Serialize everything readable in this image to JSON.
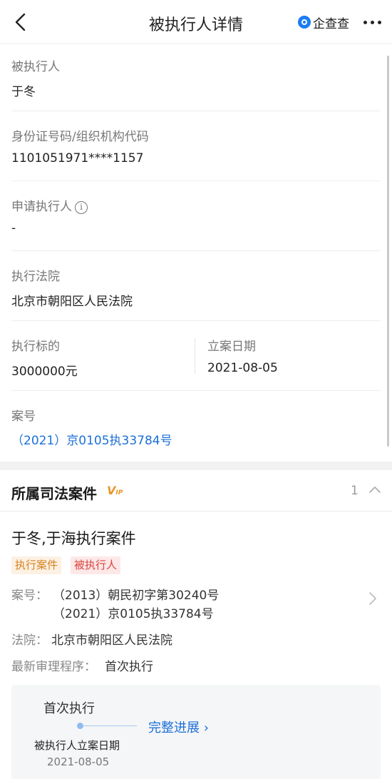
{
  "nav": {
    "title": "被执行人详情",
    "brand": "企查查"
  },
  "fields": {
    "person_label": "被执行人",
    "person_value": "于冬",
    "id_label": "身份证号码/组织机构代码",
    "id_value": "1101051971****1157",
    "applicant_label": "申请执行人",
    "applicant_value": "-",
    "court_label": "执行法院",
    "court_value": "北京市朝阳区人民法院",
    "target_label": "执行标的",
    "target_value": "3000000元",
    "filing_label": "立案日期",
    "filing_value": "2021-08-05",
    "case_no_label": "案号",
    "case_no_value": "（2021）京0105执33784号"
  },
  "section": {
    "title": "所属司法案件",
    "count": "1",
    "vip": "V",
    "vip_small": "IP"
  },
  "case": {
    "title": "于冬,于海执行案件",
    "tags": [
      "执行案件",
      "被执行人"
    ],
    "case_no_label": "案号：",
    "case_no_1": "（2013）朝民初字第30240号",
    "case_no_2": "（2021）京0105执33784号",
    "court_label": "法院：",
    "court_value": "北京市朝阳区人民法院",
    "procedure_label": "最新审理程序：",
    "procedure_value": "首次执行"
  },
  "progress": {
    "stage": "首次执行",
    "full_link": "完整进展 ›",
    "event": "被执行人立案日期",
    "date": "2021-08-05"
  }
}
